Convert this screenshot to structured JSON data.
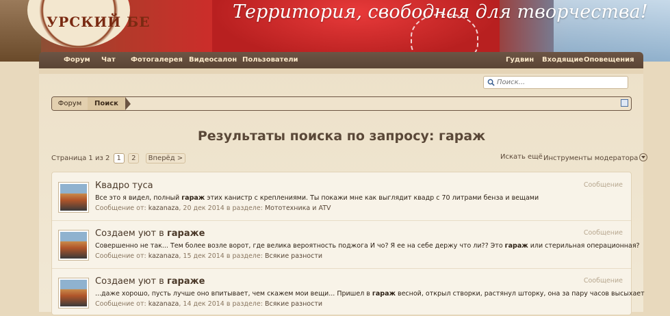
{
  "banner": {
    "logo_text": "УРСКИЙ БЕ",
    "slogan": "Территория, свободная для творчества!"
  },
  "nav": {
    "left": [
      "Форум",
      "Чат",
      "Фотогалерея",
      "Видеосалон",
      "Пользователи"
    ],
    "right": [
      "Гудвин",
      "Входящие",
      "Оповещения"
    ]
  },
  "search": {
    "placeholder": "Поиск..."
  },
  "breadcrumb": {
    "forum": "Форум",
    "search": "Поиск"
  },
  "page_title": "Результаты поиска по запросу: гараж",
  "pager": {
    "label": "Страница 1 из 2",
    "pages": [
      "1",
      "2"
    ],
    "next": "Вперёд >"
  },
  "tools": {
    "search_more": "Искать ещё",
    "moderator_tools": "Инструменты модератора"
  },
  "results": [
    {
      "title_pre": "Квадро туса",
      "title_highlight": "",
      "snippet_pre": "Все это я видел, полный ",
      "snippet_highlight": "гараж",
      "snippet_post": " этих канистр с креплениями. Ты покажи мне как выглядит квадр с 70 литрами бенза и вещами",
      "meta_prefix": "Сообщение от: ",
      "author": "kazanaza",
      "date": ", 20 дек 2014 в разделе: ",
      "section": "Мототехника и ATV",
      "type": "Сообщение"
    },
    {
      "title_pre": "Создаем уют в ",
      "title_highlight": "гараже",
      "snippet_pre": "Совершенно не так... Тем более возле ворот, где велика вероятность поджога И чо? Я ее на себе держу что ли?? Это ",
      "snippet_highlight": "гараж",
      "snippet_post": " или стерильная операционная?",
      "meta_prefix": "Сообщение от: ",
      "author": "kazanaza",
      "date": ", 15 дек 2014 в разделе: ",
      "section": "Всякие разности",
      "type": "Сообщение"
    },
    {
      "title_pre": "Создаем уют в ",
      "title_highlight": "гараже",
      "snippet_pre": "...даже хорошо, пусть лучше оно впитывает, чем скажем мои вещи... Пришел в ",
      "snippet_highlight": "гараж",
      "snippet_post": " весной, открыл створки, растянул шторку, она за пару часов высыхает",
      "meta_prefix": "Сообщение от: ",
      "author": "kazanaza",
      "date": ", 14 дек 2014 в разделе: ",
      "section": "Всякие разности",
      "type": "Сообщение"
    }
  ]
}
